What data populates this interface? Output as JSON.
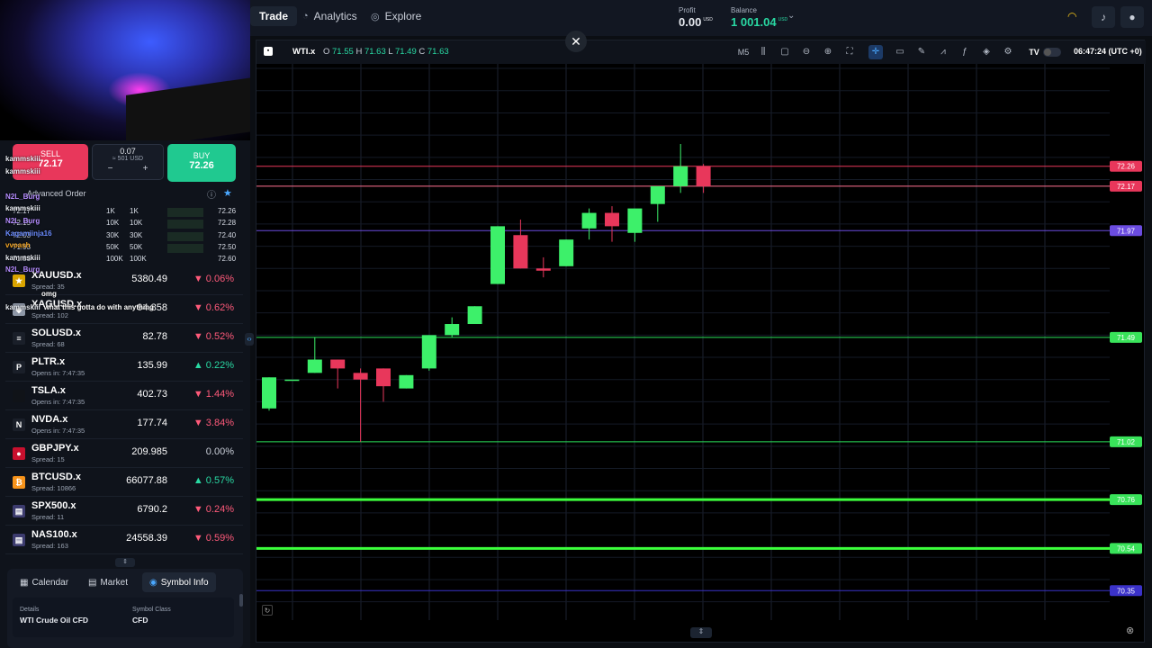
{
  "nav": {
    "tabs": [
      {
        "label": "Trade",
        "icon": "chart-icon",
        "active": true
      },
      {
        "label": "Analytics",
        "icon": "analytics-icon",
        "active": false
      },
      {
        "label": "Explore",
        "icon": "compass-icon",
        "active": false
      }
    ],
    "profit_label": "Profit",
    "profit_value": "0.00",
    "profit_ccy": "USD",
    "balance_label": "Balance",
    "balance_value": "1 001.04",
    "balance_ccy": "USD"
  },
  "order": {
    "sell_label": "SELL",
    "sell_price": "72.17",
    "qty_value": "0.07",
    "qty_usd": "≈ 501 USD",
    "minus": "−",
    "plus": "+",
    "buy_label": "BUY",
    "buy_price": "72.26",
    "advanced_label": "Advanced Order"
  },
  "depth": [
    {
      "bid": "72.17",
      "bid_vol": "1K",
      "ask_vol": "1K",
      "ask": "72.26"
    },
    {
      "bid": "72.15",
      "bid_vol": "10K",
      "ask_vol": "10K",
      "ask": "72.28"
    },
    {
      "bid": "72.03",
      "bid_vol": "30K",
      "ask_vol": "30K",
      "ask": "72.40"
    },
    {
      "bid": "71.93",
      "bid_vol": "50K",
      "ask_vol": "50K",
      "ask": "72.50"
    },
    {
      "bid": "71.83",
      "bid_vol": "100K",
      "ask_vol": "100K",
      "ask": "72.60"
    }
  ],
  "watchlist": [
    {
      "sym": "XAUUSD.x",
      "sub": "Spread: 35",
      "price": "5380.49",
      "chg": "▼ 0.06%",
      "dir": "neg",
      "ico": "★",
      "color": "#d9a400"
    },
    {
      "sym": "XAGUSD.x",
      "sub": "Spread: 102",
      "price": "94.858",
      "chg": "▼ 0.62%",
      "dir": "neg",
      "ico": "◆",
      "color": "#8f98a8"
    },
    {
      "sym": "SOLUSD.x",
      "sub": "Spread: 68",
      "price": "82.78",
      "chg": "▼ 0.52%",
      "dir": "neg",
      "ico": "≡",
      "color": "#1a1f29"
    },
    {
      "sym": "PLTR.x",
      "sub": "Opens in: 7:47:35",
      "price": "135.99",
      "chg": "▲ 0.22%",
      "dir": "pos",
      "ico": "P",
      "color": "#1a1f29"
    },
    {
      "sym": "TSLA.x",
      "sub": "Opens in: 7:47:35",
      "price": "402.73",
      "chg": "▼ 1.44%",
      "dir": "neg",
      "ico": "",
      "color": "#101318"
    },
    {
      "sym": "NVDA.x",
      "sub": "Opens in: 7:47:35",
      "price": "177.74",
      "chg": "▼ 3.84%",
      "dir": "neg",
      "ico": "N",
      "color": "#1a1f29"
    },
    {
      "sym": "GBPJPY.x",
      "sub": "Spread: 15",
      "price": "209.985",
      "chg": "0.00%",
      "dir": "flat",
      "ico": "●",
      "color": "#c8102e"
    },
    {
      "sym": "BTCUSD.x",
      "sub": "Spread: 10866",
      "price": "66077.88",
      "chg": "▲ 0.57%",
      "dir": "pos",
      "ico": "₿",
      "color": "#f7931a"
    },
    {
      "sym": "SPX500.x",
      "sub": "Spread: 11",
      "price": "6790.2",
      "chg": "▼ 0.24%",
      "dir": "neg",
      "ico": "▤",
      "color": "#3c3b6e"
    },
    {
      "sym": "NAS100.x",
      "sub": "Spread: 163",
      "price": "24558.39",
      "chg": "▼ 0.59%",
      "dir": "neg",
      "ico": "▤",
      "color": "#3c3b6e"
    }
  ],
  "bottom_tabs": [
    {
      "label": "Calendar",
      "icon": "calendar-icon"
    },
    {
      "label": "Market",
      "icon": "newspaper-icon"
    },
    {
      "label": "Symbol Info",
      "icon": "info-icon"
    }
  ],
  "symbol_info": {
    "details_label": "Details",
    "details_value": "WTI Crude Oil CFD",
    "class_label": "Symbol Class",
    "class_value": "CFD"
  },
  "chat": [
    {
      "user": "kammskiii",
      "msg": "",
      "color": "#e6e9ef"
    },
    {
      "user": "kammskiii",
      "msg": "",
      "color": "#e6e9ef"
    },
    {
      "user": "N2L_Burg",
      "msg": "",
      "color": "#b58cff"
    },
    {
      "user": "kammskiii",
      "msg": "",
      "color": "#e6e9ef"
    },
    {
      "user": "N2L_Burg",
      "msg": "",
      "color": "#b58cff"
    },
    {
      "user": "Kagamiinja16",
      "msg": "",
      "color": "#6b8cff"
    },
    {
      "user": "vvoash",
      "msg": "",
      "color": "#f5a623"
    },
    {
      "user": "kammskiii",
      "msg": "",
      "color": "#e6e9ef"
    },
    {
      "user": "N2L_Burg",
      "msg": "",
      "color": "#b58cff"
    },
    {
      "user": "",
      "msg": "omg",
      "color": "#e6e9ef"
    },
    {
      "user": "kammskiii",
      "msg": "what this gotta do with anything",
      "color": "#e6e9ef"
    }
  ],
  "chart": {
    "symbol": "WTI.x",
    "o_label": "O",
    "o": "71.55",
    "h_label": "H",
    "h": "71.63",
    "l_label": "L",
    "l": "71.49",
    "c_label": "C",
    "c": "71.63",
    "timeframe": "M5",
    "clock": "06:47:24 (UTC +0)"
  },
  "chart_data": {
    "type": "candlestick",
    "ylim": [
      70.25,
      72.68
    ],
    "candles": [
      {
        "o": 71.17,
        "h": 71.31,
        "l": 71.16,
        "c": 71.31
      },
      {
        "o": 71.3,
        "h": 71.3,
        "l": 71.3,
        "c": 71.3
      },
      {
        "o": 71.33,
        "h": 71.49,
        "l": 71.33,
        "c": 71.39
      },
      {
        "o": 71.39,
        "h": 71.39,
        "l": 71.26,
        "c": 71.35
      },
      {
        "o": 71.33,
        "h": 71.35,
        "l": 71.02,
        "c": 71.3
      },
      {
        "o": 71.35,
        "h": 71.35,
        "l": 71.2,
        "c": 71.27
      },
      {
        "o": 71.26,
        "h": 71.32,
        "l": 71.26,
        "c": 71.32
      },
      {
        "o": 71.35,
        "h": 71.5,
        "l": 71.34,
        "c": 71.5
      },
      {
        "o": 71.5,
        "h": 71.58,
        "l": 71.49,
        "c": 71.55
      },
      {
        "o": 71.55,
        "h": 71.63,
        "l": 71.55,
        "c": 71.63
      },
      {
        "o": 71.73,
        "h": 71.99,
        "l": 71.73,
        "c": 71.99
      },
      {
        "o": 71.95,
        "h": 72.02,
        "l": 71.8,
        "c": 71.8
      },
      {
        "o": 71.8,
        "h": 71.85,
        "l": 71.76,
        "c": 71.79
      },
      {
        "o": 71.81,
        "h": 71.93,
        "l": 71.81,
        "c": 71.93
      },
      {
        "o": 71.98,
        "h": 72.07,
        "l": 71.93,
        "c": 72.05
      },
      {
        "o": 72.05,
        "h": 72.08,
        "l": 71.92,
        "c": 71.99
      },
      {
        "o": 71.96,
        "h": 72.06,
        "l": 71.92,
        "c": 72.07
      },
      {
        "o": 72.09,
        "h": 72.17,
        "l": 72.01,
        "c": 72.17
      },
      {
        "o": 72.17,
        "h": 72.36,
        "l": 72.14,
        "c": 72.26
      },
      {
        "o": 72.26,
        "h": 72.27,
        "l": 72.14,
        "c": 72.17
      }
    ],
    "price_lines": [
      {
        "price": "72.26",
        "color": "#e8375b",
        "width": 1
      },
      {
        "price": "72.17",
        "color": "#ff6f91",
        "width": 1
      },
      {
        "price": "71.97",
        "color": "#6b4ce0",
        "width": 1
      },
      {
        "price": "71.49",
        "color": "#29e05a",
        "width": 1
      },
      {
        "price": "71.02",
        "color": "#29e05a",
        "width": 1
      },
      {
        "price": "70.76",
        "color": "#3cff3c",
        "width": 3
      },
      {
        "price": "70.54",
        "color": "#3cff3c",
        "width": 3
      },
      {
        "price": "70.35",
        "color": "#3b32c9",
        "width": 1
      }
    ],
    "tag_colors": {
      "72.26": "#e8375b",
      "72.17": "#e8375b",
      "71.97": "#6b4ce0",
      "71.49": "#39e35a",
      "71.02": "#39e35a",
      "70.76": "#39e35a",
      "70.54": "#39e35a",
      "70.35": "#3b32c9"
    }
  }
}
